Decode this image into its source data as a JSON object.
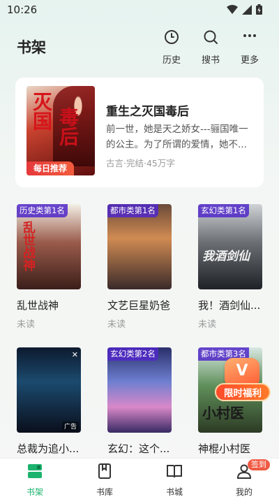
{
  "status_bar": {
    "time": "10:26"
  },
  "header": {
    "title": "书架",
    "actions": [
      {
        "label": "历史",
        "icon": "clock-icon"
      },
      {
        "label": "搜书",
        "icon": "search-icon"
      },
      {
        "label": "更多",
        "icon": "more-icon"
      }
    ]
  },
  "featured": {
    "badge": "每日推荐",
    "title": "重生之灭国毒后",
    "description": "前一世，她是天之娇女---骊国唯一的公主。为了所谓的爱情，她不...",
    "meta": "古言·完结·45万字",
    "cover_art_1": "灭国",
    "cover_art_2": "毒后"
  },
  "books": [
    {
      "rank": "历史类第1名",
      "name": "乱世战神",
      "status": "未读",
      "cover_text": "乱世战神"
    },
    {
      "rank": "都市类第1名",
      "name": "文艺巨星奶爸",
      "status": "未读",
      "cover_text": ""
    },
    {
      "rank": "玄幻类第1名",
      "name": "我！酒剑仙...",
      "status": "未读",
      "cover_text": "我酒剑仙"
    },
    {
      "rank": "",
      "name": "总裁为追小...",
      "status": "",
      "cover_text": "",
      "ad": "广告"
    },
    {
      "rank": "玄幻类第2名",
      "name": "玄幻：这个...",
      "status": "",
      "cover_text": ""
    },
    {
      "rank": "都市类第3名",
      "name": "神棍小村医",
      "status": "",
      "cover_text": "小村医"
    }
  ],
  "promo": {
    "label": "限时福利",
    "glyph": "V"
  },
  "bottom_nav": {
    "items": [
      {
        "label": "书架",
        "icon": "bookshelf-icon",
        "active": true
      },
      {
        "label": "书库",
        "icon": "library-icon",
        "active": false
      },
      {
        "label": "书城",
        "icon": "bookstore-icon",
        "active": false
      },
      {
        "label": "我的",
        "icon": "profile-icon",
        "active": false
      }
    ],
    "signin_badge": "签到"
  },
  "colors": {
    "accent": "#1bb36e",
    "badge_red": "#e5383b",
    "rank_purple": "#5028c8"
  }
}
